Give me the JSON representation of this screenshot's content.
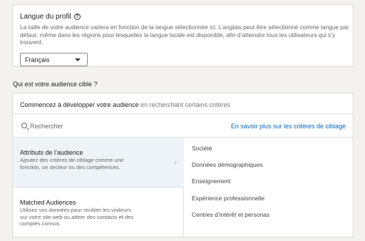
{
  "profile": {
    "title": "Langue du profil",
    "help_icon": "help-circle-icon",
    "description": "La taille de votre audience variera en fonction de la langue sélectionnée ici. L’anglais peut être sélectionné comme langue par défaut, même dans les régions pour lesquelles la langue locale est disponible, afin d’atteindre tous les utilisateurs qui s’y trouvent.",
    "language_selected": "Français"
  },
  "audience": {
    "section_title": "Qui est votre audience cible ?",
    "header_bold": "Commencez à développer votre audience",
    "header_light": " en recherchant certains critères",
    "search_placeholder": "Rechercher",
    "learn_more": "En savoir plus sur les critères de ciblage",
    "categories": [
      {
        "title": "Attributs de l’audience",
        "description": "Ajoutez des critères de ciblage comme une fonction, un secteur ou des compétences.",
        "selected": true
      },
      {
        "title": "Matched Audiences",
        "description": "Utilisez vos données pour recibler les visiteurs sur votre site web ou attirer des contacts et des comptes connus.",
        "selected": false
      }
    ],
    "options": [
      "Société",
      "Données démographiques",
      "Enseignement",
      "Expérience professionnelle",
      "Centres d’intérêt et personas"
    ]
  },
  "colors": {
    "link": "#0a66c2",
    "selected_bg": "#eef3f8",
    "page_bg": "#f3f2ef"
  }
}
